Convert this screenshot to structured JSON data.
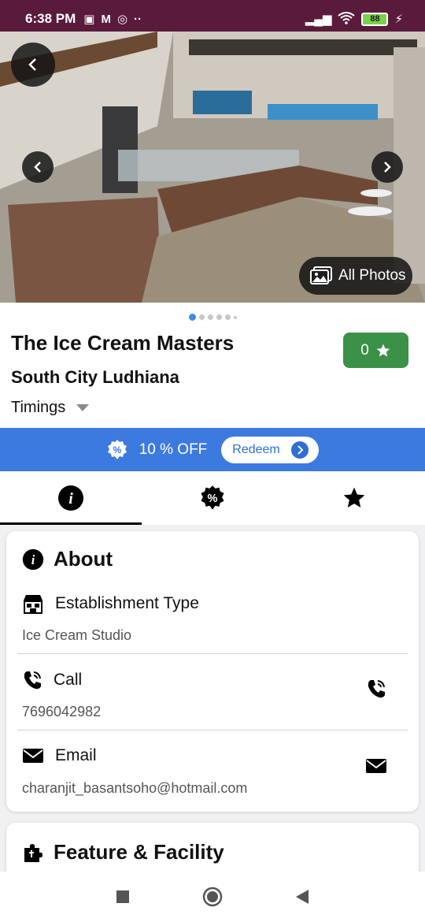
{
  "status_bar": {
    "time": "6:38 PM",
    "battery": "88"
  },
  "hero": {
    "all_photos_label": "All Photos",
    "dots_count": 6,
    "active_dot": 0
  },
  "venue": {
    "name": "The Ice Cream Masters",
    "location": "South City Ludhiana",
    "timings_label": "Timings",
    "rating": "0"
  },
  "offer": {
    "text": "10 % OFF",
    "redeem_label": "Redeem"
  },
  "tabs": [
    {
      "icon": "info-icon",
      "active": true
    },
    {
      "icon": "discount-icon",
      "active": false
    },
    {
      "icon": "star-icon",
      "active": false
    }
  ],
  "about": {
    "heading": "About",
    "establishment_label": "Establishment Type",
    "establishment_value": "Ice Cream Studio",
    "call_label": "Call",
    "call_value": "7696042982",
    "email_label": "Email",
    "email_value": "charanjit_basantsoho@hotmail.com"
  },
  "features": {
    "heading": "Feature & Facility"
  },
  "colors": {
    "status_bar": "#5a1a3c",
    "offer_bar": "#3d7ae0",
    "rating_badge": "#3b9147",
    "accent_dot": "#3b8fe3"
  }
}
